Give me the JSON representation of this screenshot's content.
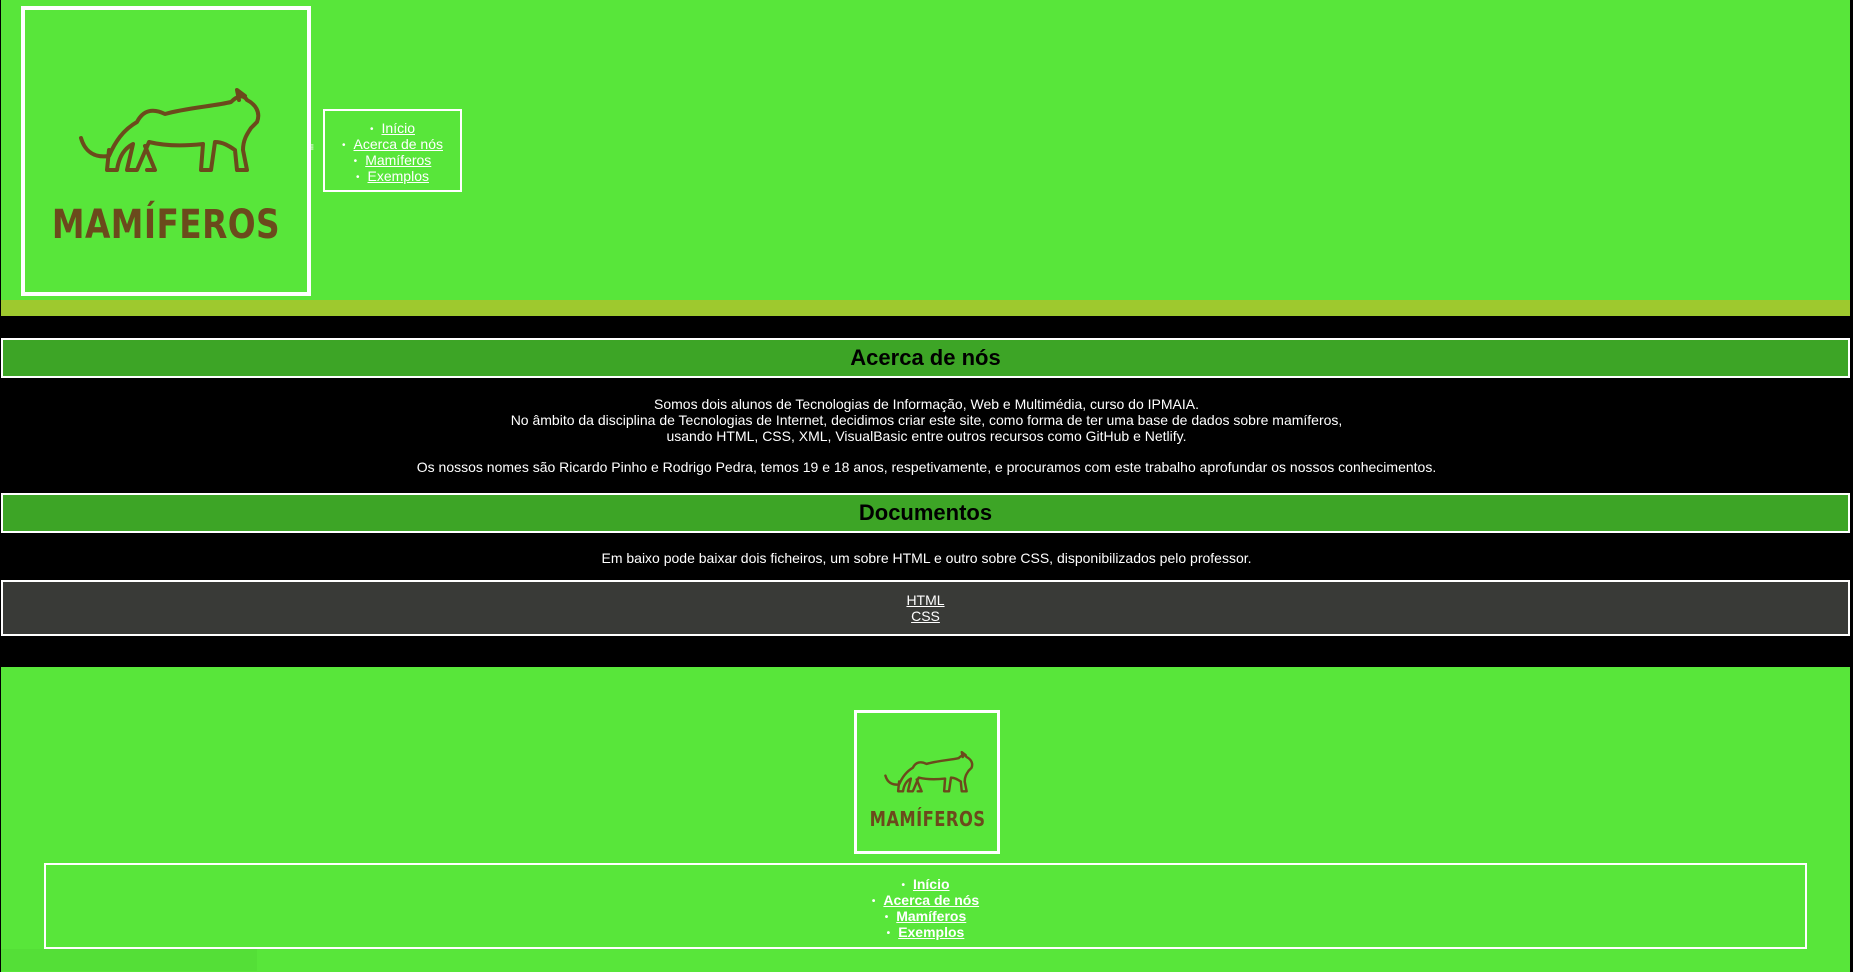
{
  "header": {
    "logo": {
      "alt_text": "MAMÍFEROS",
      "icon": "cat-outline-icon",
      "text_color": "#6b4a1c"
    },
    "menu_icon": "hamburger-icon",
    "nav": [
      {
        "label": "Início"
      },
      {
        "label": "Acerca de nós"
      },
      {
        "label": "Mamíferos"
      },
      {
        "label": "Exemplos"
      }
    ]
  },
  "about": {
    "heading": "Acerca de nós",
    "lines": [
      "Somos dois alunos de Tecnologias de Informação, Web e Multimédia, curso do IPMAIA.",
      "No âmbito da disciplina de Tecnologias de Internet, decidimos criar este site, como forma de ter uma base de dados sobre mamíferos,",
      "usando HTML, CSS, XML, VisualBasic entre outros recursos como GitHub e Netlify."
    ],
    "names_line": "Os nossos nomes são Ricardo Pinho e Rodrigo Pedra, temos 19 e 18 anos, respetivamente, e procuramos com este trabalho aprofundar os nossos conhecimentos."
  },
  "documents": {
    "heading": "Documentos",
    "description": "Em baixo pode baixar dois ficheiros, um sobre HTML e outro sobre CSS, disponibilizados pelo professor.",
    "links": [
      {
        "label": "HTML"
      },
      {
        "label": "CSS"
      }
    ]
  },
  "footer": {
    "logo": {
      "alt_text": "MAMÍFEROS",
      "icon": "cat-outline-icon"
    },
    "nav": [
      {
        "label": "Início"
      },
      {
        "label": "Acerca de nós"
      },
      {
        "label": "Mamíferos"
      },
      {
        "label": "Exemplos"
      }
    ]
  },
  "colors": {
    "header_bg": "#58e63a",
    "strip": "#9ec92e",
    "section_bar": "#3da526",
    "docs_bg": "#393a37",
    "page_bg": "#000000",
    "logo_brown": "#6b4a1c"
  }
}
